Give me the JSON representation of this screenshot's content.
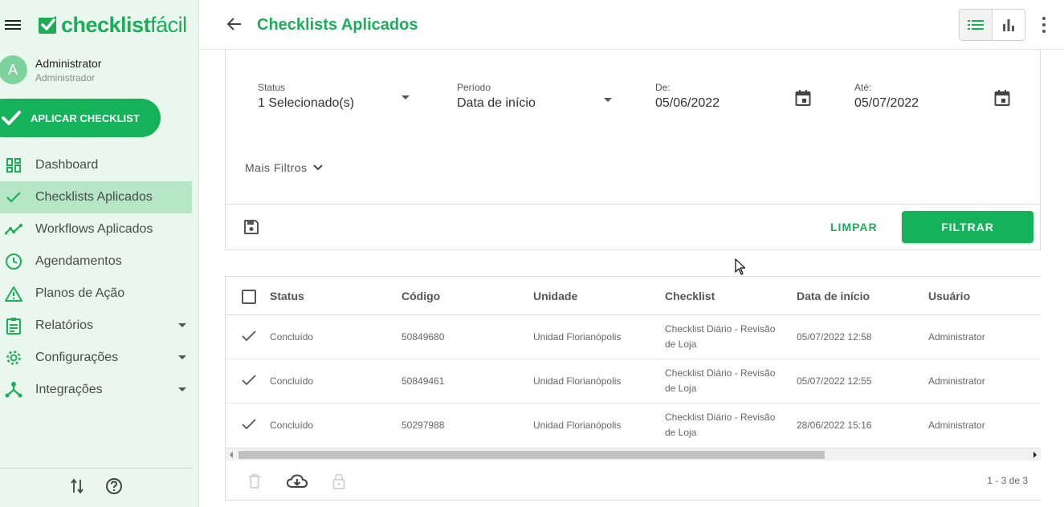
{
  "brand": {
    "logo_bold": "checklist",
    "logo_light": "fácil",
    "color": "#1cad58"
  },
  "user": {
    "initial": "A",
    "name": "Administrator",
    "role": "Administrador"
  },
  "apply_button": "APLICAR CHECKLIST",
  "nav": {
    "items": [
      {
        "label": "Dashboard",
        "icon": "dashboard-icon"
      },
      {
        "label": "Checklists Aplicados",
        "icon": "check-icon",
        "active": true
      },
      {
        "label": "Workflows Aplicados",
        "icon": "trend-icon"
      },
      {
        "label": "Agendamentos",
        "icon": "clock-icon"
      },
      {
        "label": "Planos de Ação",
        "icon": "warning-icon"
      },
      {
        "label": "Relatórios",
        "icon": "clipboard-icon",
        "expandable": true
      },
      {
        "label": "Configurações",
        "icon": "gear-icon",
        "expandable": true
      },
      {
        "label": "Integrações",
        "icon": "hub-icon",
        "expandable": true
      }
    ]
  },
  "header": {
    "title": "Checklists Aplicados"
  },
  "filters": {
    "status": {
      "label": "Status",
      "value": "1 Selecionado(s)"
    },
    "period": {
      "label": "Período",
      "value": "Data de início"
    },
    "from": {
      "label": "De:",
      "value": "05/06/2022"
    },
    "to": {
      "label": "Até:",
      "value": "05/07/2022"
    },
    "more": "Mais Filtros",
    "clear": "LIMPAR",
    "apply": "FILTRAR"
  },
  "table": {
    "columns": [
      "Status",
      "Código",
      "Unidade",
      "Checklist",
      "Data de início",
      "Usuário"
    ],
    "rows": [
      {
        "status": "Concluído",
        "code": "50849680",
        "unit": "Unidad Florianópolis",
        "checklist_1": "Checklist Diário - Revisão",
        "checklist_2": "de Loja",
        "start": "05/07/2022 12:58",
        "user": "Administrator"
      },
      {
        "status": "Concluído",
        "code": "50849461",
        "unit": "Unidad Florianópolis",
        "checklist_1": "Checklist Diário - Revisão",
        "checklist_2": "de Loja",
        "start": "05/07/2022 12:55",
        "user": "Administrator"
      },
      {
        "status": "Concluído",
        "code": "50297988",
        "unit": "Unidad Florianópolis",
        "checklist_1": "Checklist Diário - Revisão",
        "checklist_2": "de Loja",
        "start": "28/06/2022 15:16",
        "user": "Administrator"
      }
    ],
    "pagination": "1 - 3 de 3"
  }
}
